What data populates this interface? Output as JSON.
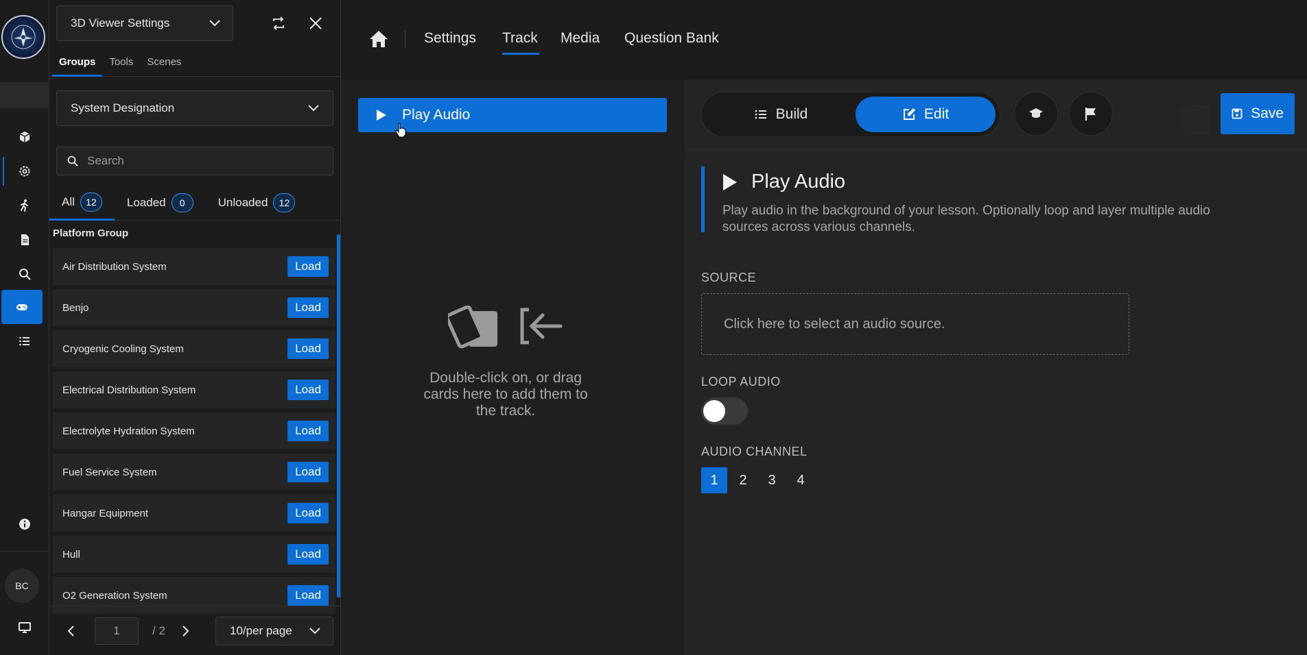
{
  "panel": {
    "viewer_select": "3D Viewer Settings",
    "tabs": [
      {
        "label": "Groups",
        "active": true
      },
      {
        "label": "Tools",
        "active": false
      },
      {
        "label": "Scenes",
        "active": false
      }
    ],
    "designation": "System Designation",
    "search_placeholder": "Search",
    "filters": [
      {
        "label": "All",
        "count": "12"
      },
      {
        "label": "Loaded",
        "count": "0"
      },
      {
        "label": "Unloaded",
        "count": "12"
      }
    ],
    "group_title": "Platform Group",
    "items": [
      {
        "name": "Air Distribution System",
        "action": "Load"
      },
      {
        "name": "Benjo",
        "action": "Load"
      },
      {
        "name": "Cryogenic Cooling System",
        "action": "Load"
      },
      {
        "name": "Electrical Distribution System",
        "action": "Load"
      },
      {
        "name": "Electrolyte Hydration System",
        "action": "Load"
      },
      {
        "name": "Fuel Service System",
        "action": "Load"
      },
      {
        "name": "Hangar Equipment",
        "action": "Load"
      },
      {
        "name": "Hull",
        "action": "Load"
      },
      {
        "name": "O2 Generation System",
        "action": "Load"
      }
    ],
    "pager": {
      "page": "1",
      "total": "/ 2",
      "per_page": "10/per page"
    }
  },
  "rail": {
    "avatar_initials": "BC",
    "icons": [
      "cube-icon",
      "gear-icon",
      "person-walking-icon",
      "document-icon",
      "search-icon",
      "gamepad-icon",
      "list-icon",
      "info-icon",
      "monitor-icon"
    ]
  },
  "nav": {
    "items": [
      {
        "label": "Settings",
        "active": false
      },
      {
        "label": "Track",
        "active": true
      },
      {
        "label": "Media",
        "active": false
      },
      {
        "label": "Question Bank",
        "active": false
      }
    ]
  },
  "track": {
    "card_label": "Play Audio",
    "drop_text": "Double-click on, or drag cards here to add them to the track."
  },
  "editor": {
    "build_label": "Build",
    "edit_label": "Edit",
    "save_label": "Save",
    "title": "Play Audio",
    "description": "Play audio in the background of your lesson. Optionally loop and layer multiple audio sources across various channels.",
    "source_label": "SOURCE",
    "source_placeholder": "Click here to select an audio source.",
    "loop_label": "LOOP AUDIO",
    "loop_on": false,
    "channel_label": "AUDIO CHANNEL",
    "channels": [
      "1",
      "2",
      "3",
      "4"
    ],
    "selected_channel": "1"
  },
  "colors": {
    "accent": "#0d6fd6",
    "background": "#1f1f1f",
    "panel": "#1c1c1c"
  }
}
